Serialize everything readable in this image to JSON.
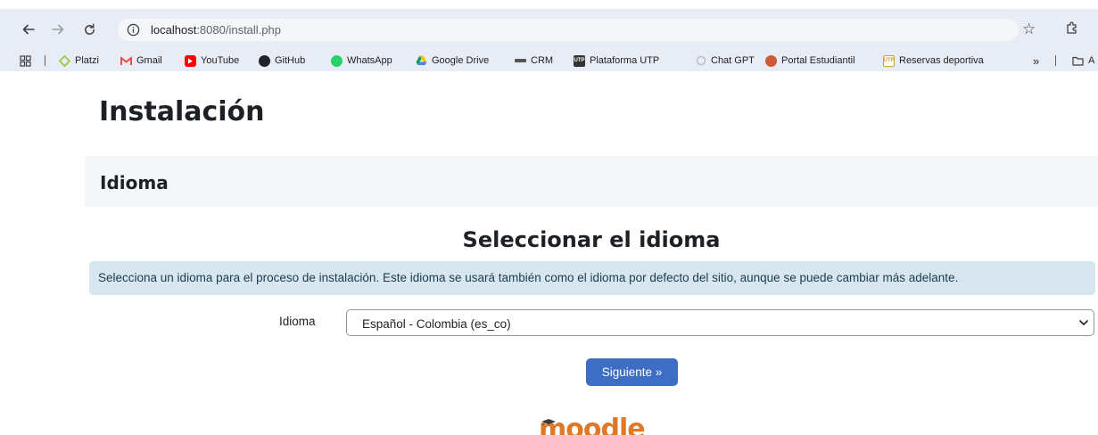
{
  "browser": {
    "url_host": "localhost",
    "url_path": ":8080/install.php",
    "icons": {
      "back": "arrow-left",
      "forward": "arrow-right",
      "reload": "reload",
      "site_info": "info",
      "bookmark_star": "star",
      "extensions": "puzzle"
    }
  },
  "bookmarks": {
    "items": [
      {
        "label": "Platzi",
        "icon": "platzi-icon",
        "color": "#98ca3f"
      },
      {
        "label": "Gmail",
        "icon": "gmail-icon",
        "color": "#ea4335"
      },
      {
        "label": "YouTube",
        "icon": "youtube-icon",
        "color": "#ff0000"
      },
      {
        "label": "GitHub",
        "icon": "github-icon",
        "color": "#1f2328"
      },
      {
        "label": "WhatsApp",
        "icon": "whatsapp-icon",
        "color": "#25d366"
      },
      {
        "label": "Google Drive",
        "icon": "google-drive-icon",
        "color": "#fbbc04"
      },
      {
        "label": "CRM",
        "icon": "crm-icon",
        "color": "#555555"
      },
      {
        "label": "Plataforma UTP",
        "icon": "utp-icon",
        "color": "#333333"
      },
      {
        "label": "Chat GPT",
        "icon": "chatgpt-icon",
        "color": "#b8bdc6"
      },
      {
        "label": "Portal Estudiantil",
        "icon": "portal-icon",
        "color": "#d0583b"
      },
      {
        "label": "Reservas deportiva",
        "icon": "utp-reservas-icon",
        "color": "#c9a227"
      }
    ],
    "overflow": "»",
    "folder_initial": "A"
  },
  "page": {
    "title": "Instalación",
    "section": "Idioma",
    "heading": "Seleccionar el idioma",
    "info_text": "Selecciona un idioma para el proceso de instalación. Este idioma se usará también como el idioma por defecto del sitio, aunque se puede cambiar más adelante.",
    "field_label": "Idioma",
    "selected_language": "Español - Colombia (es_co)",
    "next_button": "Siguiente »",
    "logo_text": "moodle"
  },
  "colors": {
    "button": "#3d6ec4",
    "alert_bg": "#d8e6ef",
    "section_bg": "#f5f6f8",
    "logo": "#e0782a"
  }
}
